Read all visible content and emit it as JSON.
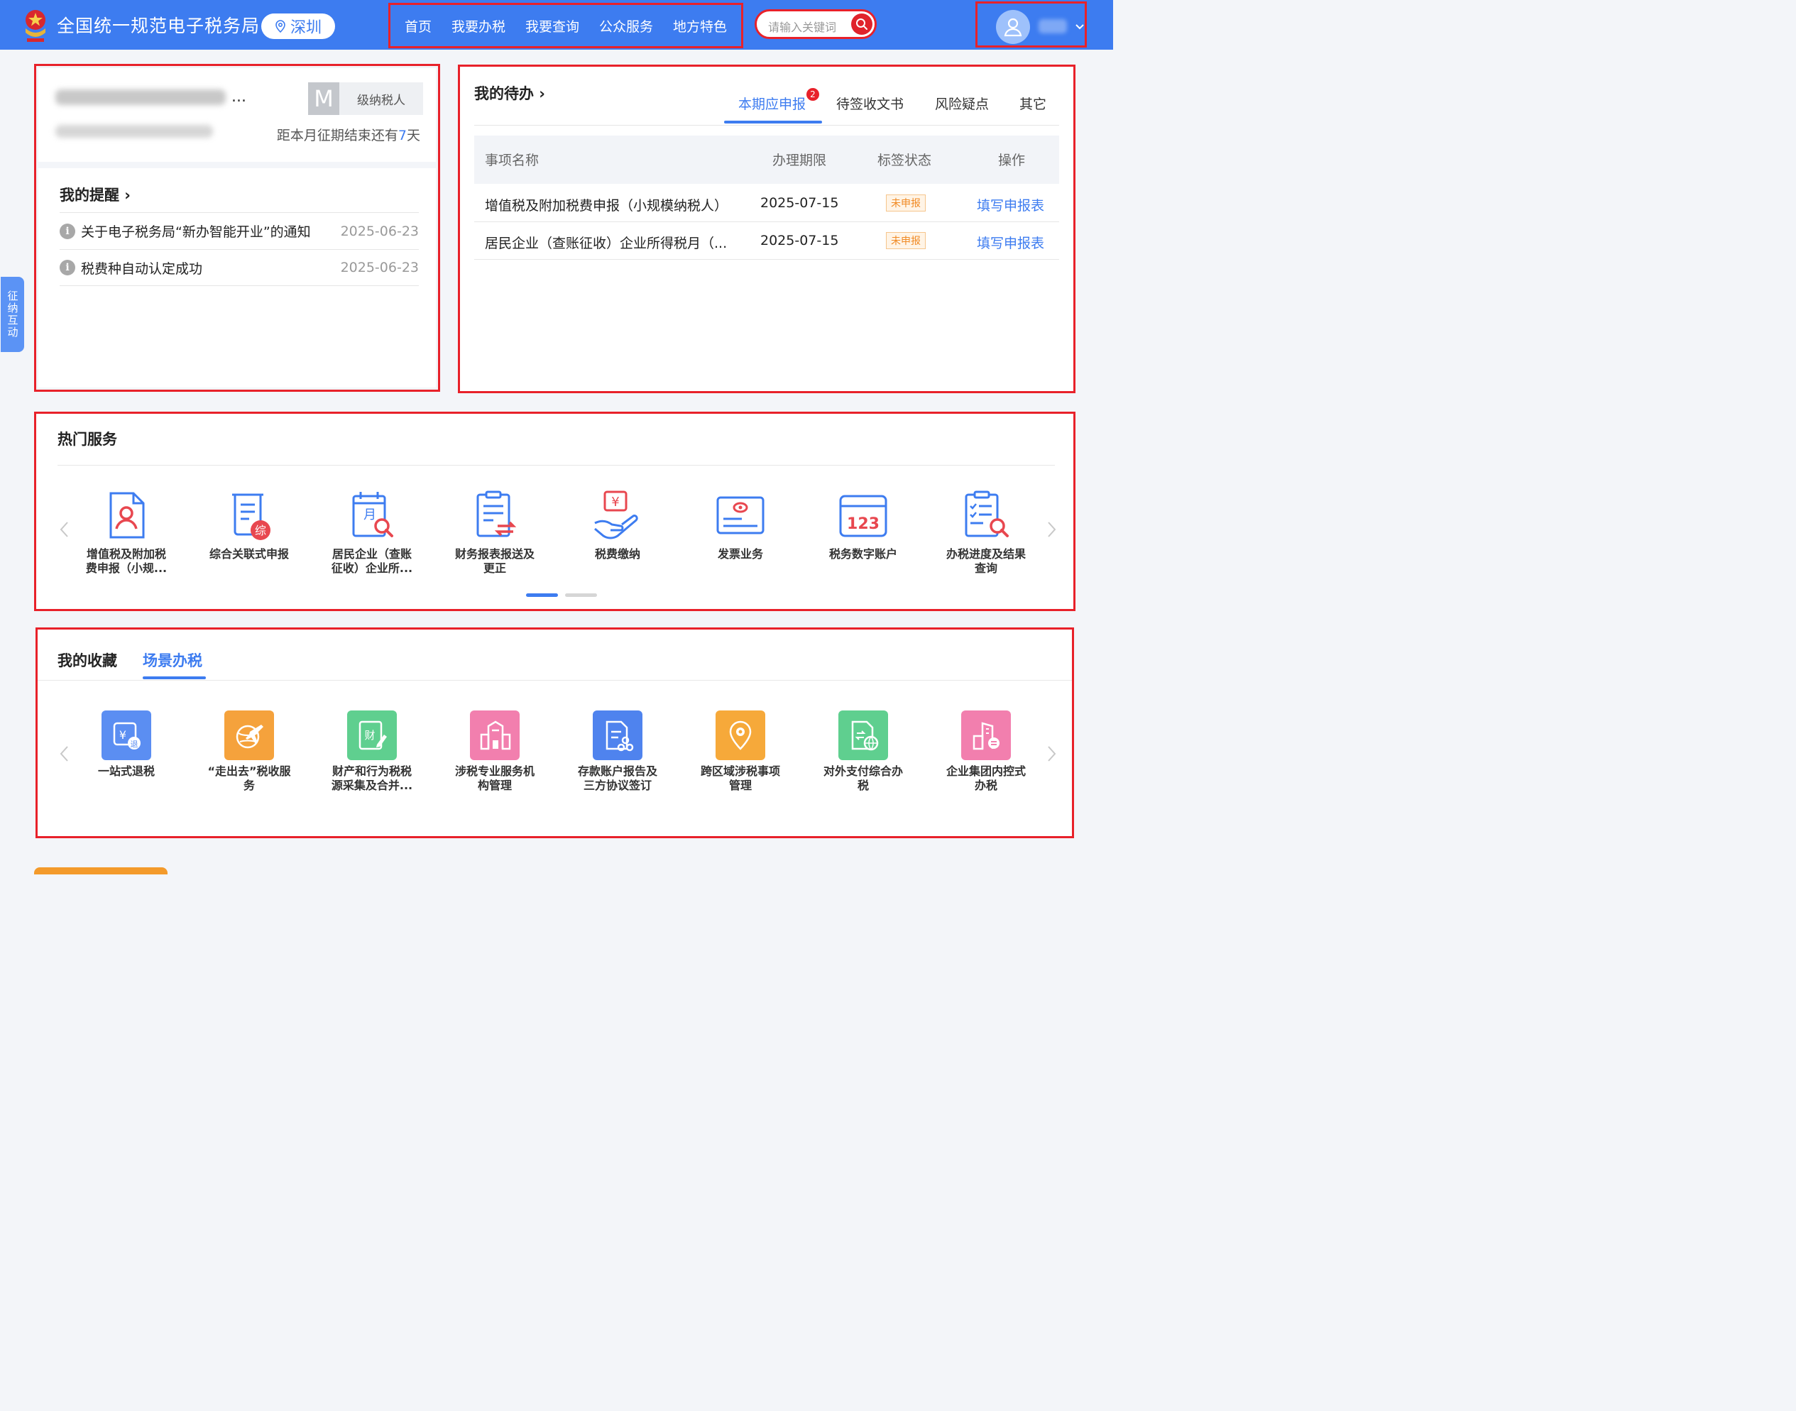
{
  "header": {
    "title": "全国统一规范电子税务局",
    "city": "深圳",
    "nav": [
      "首页",
      "我要办税",
      "我要查询",
      "公众服务",
      "地方特色"
    ],
    "search_placeholder": "请输入关键词"
  },
  "side_tab": "征纳互动",
  "taxpayer": {
    "level_letter": "M",
    "level_label": "级纳税人",
    "period_prefix": "距本月征期结束还有",
    "period_days": "7",
    "period_suffix": "天",
    "ellipsis": "..."
  },
  "reminders": {
    "title": "我的提醒",
    "items": [
      {
        "text": "关于电子税务局“新办智能开业”的通知",
        "date": "2025-06-23"
      },
      {
        "text": "税费种自动认定成功",
        "date": "2025-06-23"
      }
    ]
  },
  "todo": {
    "title": "我的待办",
    "tabs": [
      "本期应申报",
      "待签收文书",
      "风险疑点",
      "其它"
    ],
    "badge": "2",
    "columns": [
      "事项名称",
      "办理期限",
      "标签状态",
      "操作"
    ],
    "rows": [
      {
        "name": "增值税及附加税费申报（小规模纳税人）",
        "deadline": "2025-07-15",
        "status": "未申报",
        "action": "填写申报表"
      },
      {
        "name": "居民企业（查账征收）企业所得税月（...",
        "deadline": "2025-07-15",
        "status": "未申报",
        "action": "填写申报表"
      }
    ]
  },
  "hot": {
    "title": "热门服务",
    "items": [
      {
        "line1": "增值税及附加税",
        "line2": "费申报（小规...",
        "icon": "person-document-icon"
      },
      {
        "line1": "综合关联式申报",
        "line2": "",
        "icon": "scroll-integrated-icon"
      },
      {
        "line1": "居民企业（查账",
        "line2": "征收）企业所...",
        "icon": "calendar-search-icon"
      },
      {
        "line1": "财务报表报送及",
        "line2": "更正",
        "icon": "clipboard-exchange-icon"
      },
      {
        "line1": "税费缴纳",
        "line2": "",
        "icon": "hand-yuan-icon"
      },
      {
        "line1": "发票业务",
        "line2": "",
        "icon": "invoice-icon"
      },
      {
        "line1": "税务数字账户",
        "line2": "",
        "icon": "digital-account-123-icon"
      },
      {
        "line1": "办税进度及结果",
        "line2": "查询",
        "icon": "checklist-search-icon"
      }
    ],
    "page_count": 2,
    "page_active": 1
  },
  "favorites": {
    "tabs": [
      "我的收藏",
      "场景办税"
    ],
    "active_tab": 1,
    "items": [
      {
        "line1": "一站式退税",
        "line2": "",
        "color": "#5b8ef2",
        "icon": "refund-icon"
      },
      {
        "line1": "“走出去”税收服",
        "line2": "务",
        "color": "#f5a23c",
        "icon": "plane-globe-icon"
      },
      {
        "line1": "财产和行为税税",
        "line2": "源采集及合并...",
        "color": "#5fcf8f",
        "icon": "property-edit-icon"
      },
      {
        "line1": "涉税专业服务机",
        "line2": "构管理",
        "color": "#f27fae",
        "icon": "building-icon"
      },
      {
        "line1": "存款账户报告及",
        "line2": "三方协议签订",
        "color": "#4f83ee",
        "icon": "document-agreement-icon"
      },
      {
        "line1": "跨区域涉税事项",
        "line2": "管理",
        "color": "#f6a93a",
        "icon": "location-gear-icon"
      },
      {
        "line1": "对外支付综合办",
        "line2": "税",
        "color": "#5fcf8f",
        "icon": "document-globe-icon"
      },
      {
        "line1": "企业集团内控式",
        "line2": "办税",
        "color": "#f27fae",
        "icon": "enterprise-building-icon"
      }
    ]
  },
  "colors": {
    "brand": "#3d7cf0",
    "highlight": "#e8212a",
    "warning": "#f08a24"
  }
}
